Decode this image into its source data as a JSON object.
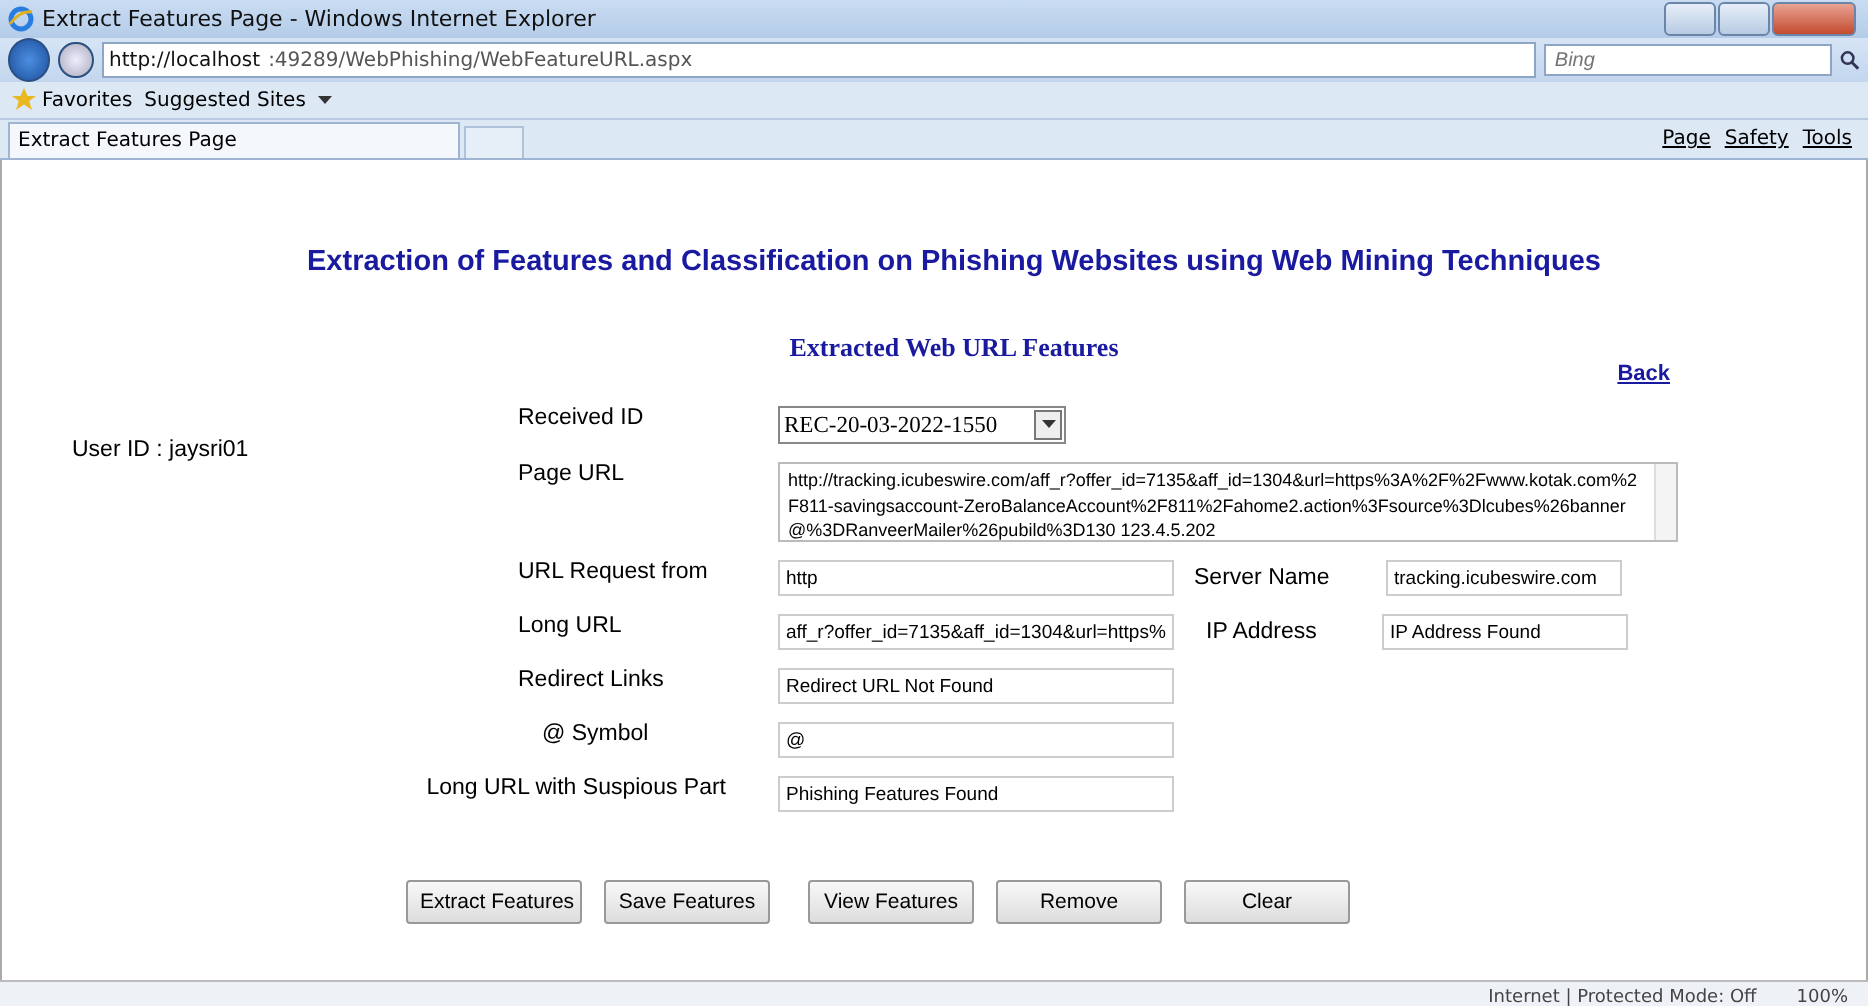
{
  "window": {
    "title": "Extract Features Page - Windows Internet Explorer"
  },
  "browser": {
    "address_host": "http://localhost",
    "address_rest": ":49289/WebPhishing/WebFeatureURL.aspx",
    "search_placeholder": "Bing",
    "favorites": "Favorites",
    "suggested_sites": "Suggested Sites",
    "tab": "Extract Features Page",
    "commands": [
      "Page",
      "Safety",
      "Tools"
    ]
  },
  "page": {
    "heading": "Extraction of Features and Classification on Phishing Websites using Web Mining Techniques",
    "subheading": "Extracted Web URL Features",
    "back_link": "Back",
    "user_id": "User ID : jaysri01",
    "rows": [
      {
        "kind": "select",
        "label": "Received ID",
        "value": "REC-20-03-2022-1550"
      },
      {
        "kind": "textarea",
        "label": "Page URL",
        "value": "http://tracking.icubeswire.com/aff_r?offer_id=7135&aff_id=1304&url=https%3A%2F%2Fwww.kotak.com%2F811-savingsaccount-ZeroBalanceAccount%2F811%2Fahome2.action%3Fsource%3Dlcubes%26banner@%3DRanveerMailer%26pubild%3D130 123.4.5.202"
      },
      {
        "kind": "input",
        "label": "URL Request from",
        "value": "http",
        "side": {
          "label": "Server Name",
          "value": "tracking.icubeswire.com"
        }
      },
      {
        "kind": "input",
        "label": "Long URL",
        "value": "aff_r?offer_id=7135&aff_id=1304&url=https%",
        "side": {
          "label": "IP Address",
          "value": "IP Address Found"
        }
      },
      {
        "kind": "input",
        "label": "Redirect Links",
        "value": "Redirect URL Not Found"
      },
      {
        "kind": "input",
        "label": "@ Symbol",
        "value": "@"
      },
      {
        "kind": "wide",
        "label": "Long URL with Suspious Part",
        "value": "Phishing Features Found"
      }
    ],
    "buttons": [
      "Extract Features",
      "Save Features",
      "View  Features",
      "Remove",
      "Clear"
    ]
  },
  "status_bar": {
    "zone": "Internet | Protected Mode: Off",
    "zoom": "100%"
  }
}
